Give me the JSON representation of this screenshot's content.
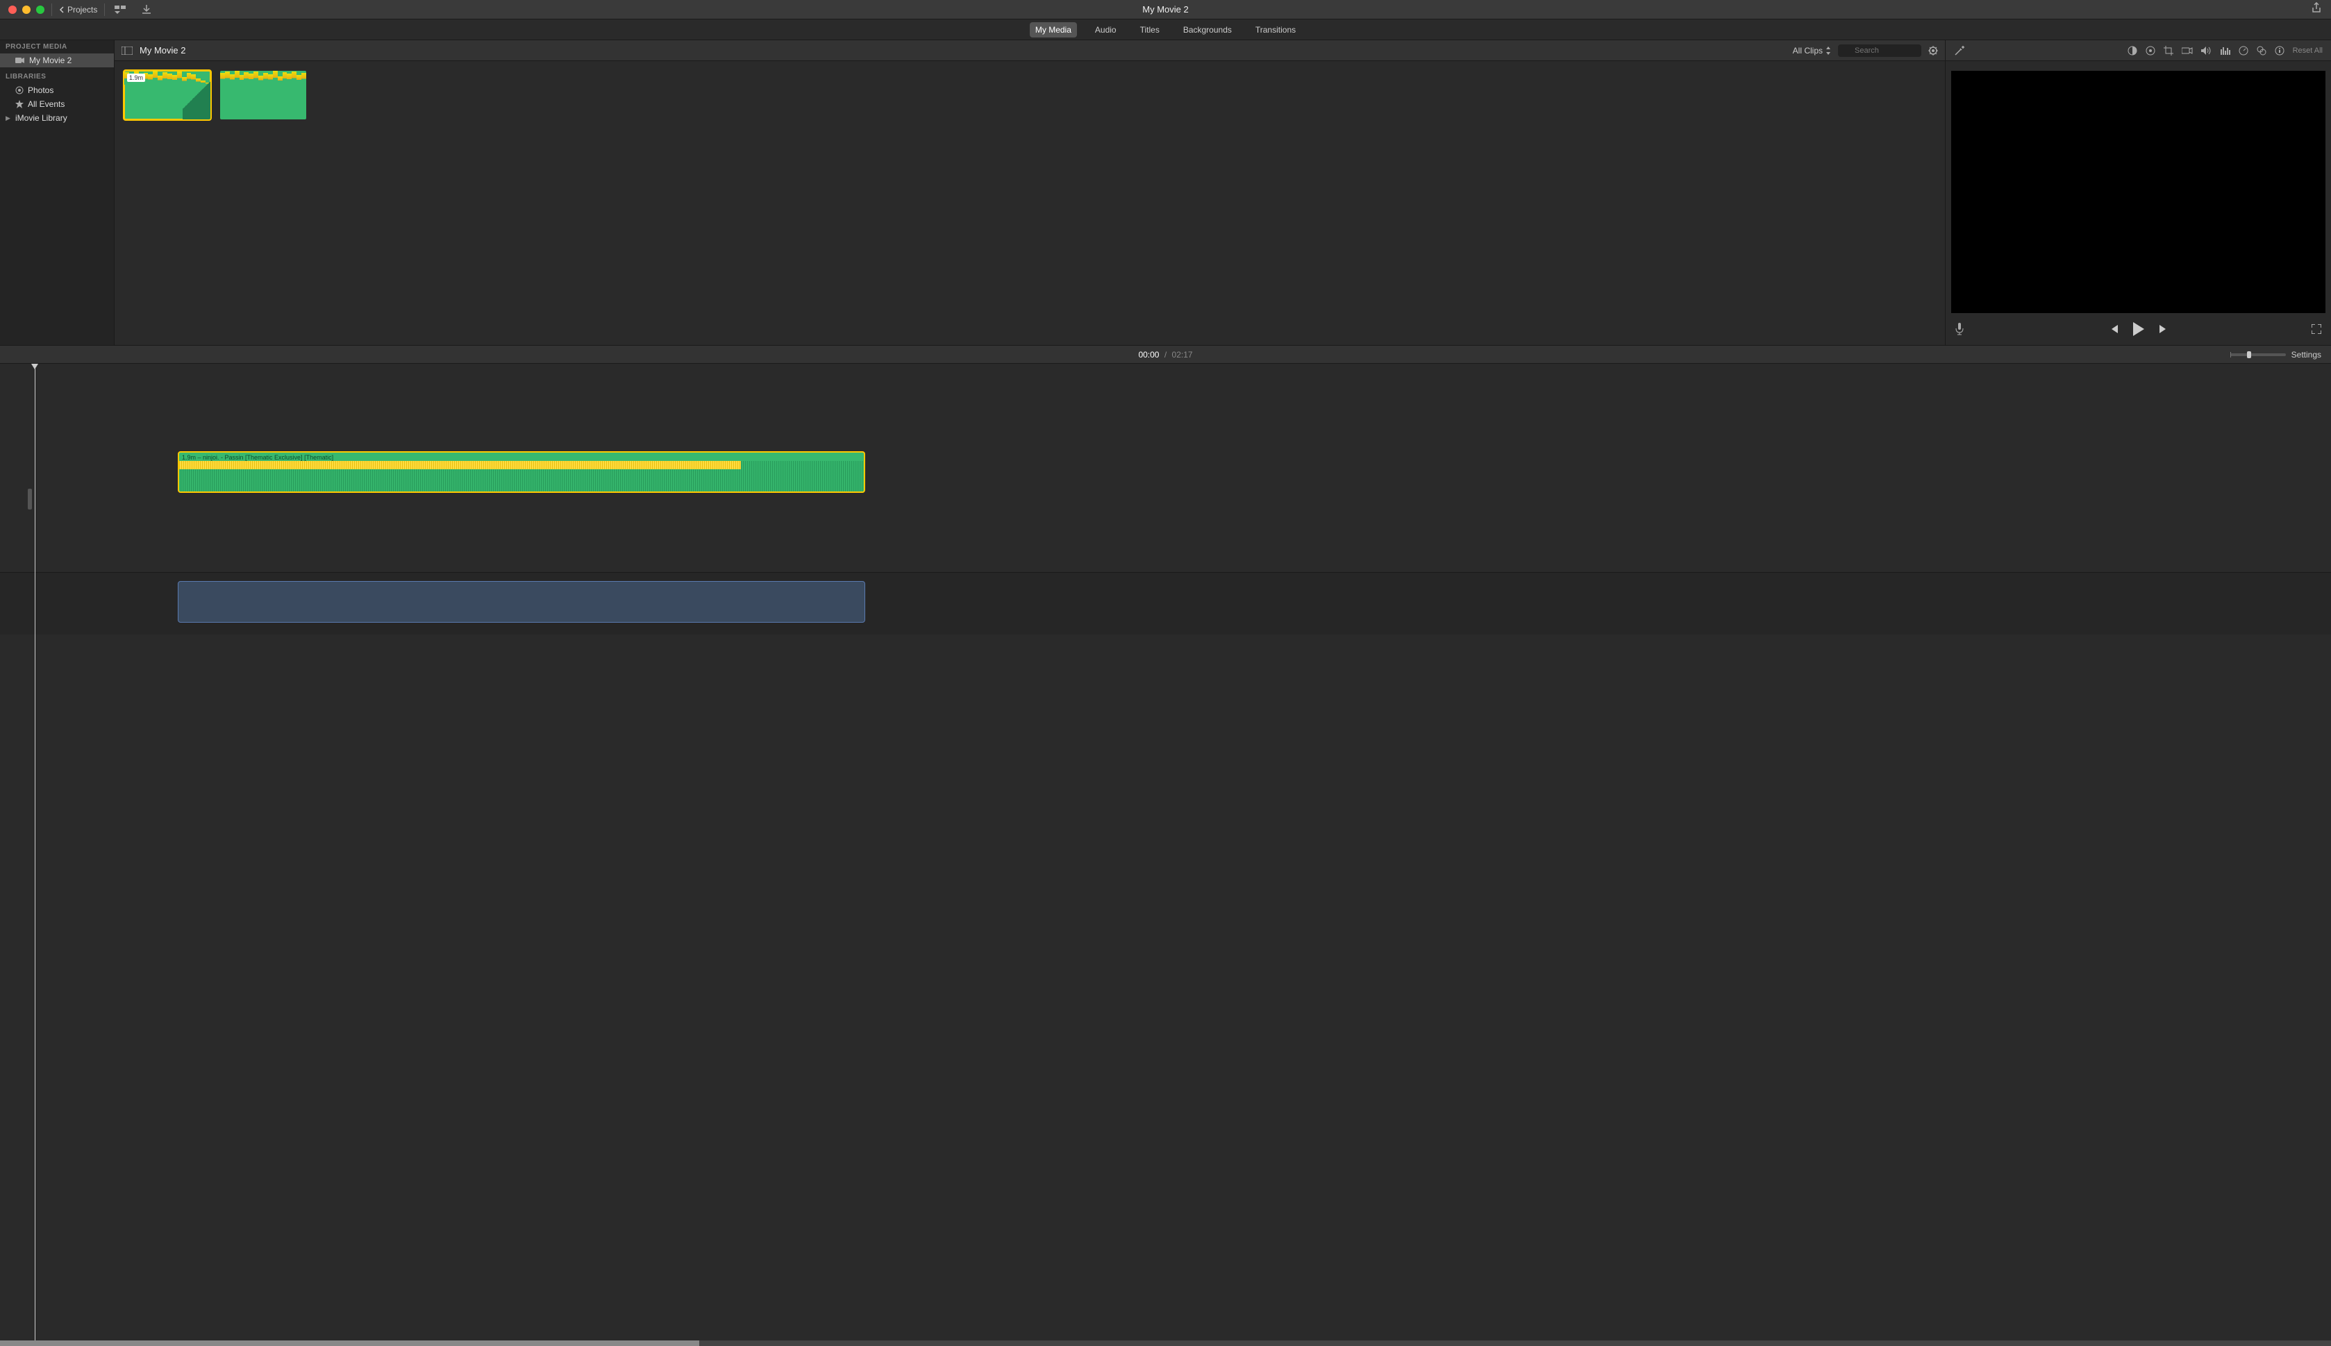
{
  "titlebar": {
    "projects_label": "Projects",
    "window_title": "My Movie 2"
  },
  "content_tabs": {
    "my_media": "My Media",
    "audio": "Audio",
    "titles": "Titles",
    "backgrounds": "Backgrounds",
    "transitions": "Transitions"
  },
  "viewer_toolbar": {
    "reset_all": "Reset All"
  },
  "sidebar": {
    "project_media_label": "PROJECT MEDIA",
    "project_name": "My Movie 2",
    "libraries_label": "LIBRARIES",
    "photos": "Photos",
    "all_events": "All Events",
    "imovie_library": "iMovie Library"
  },
  "browser": {
    "title": "My Movie 2",
    "filter_label": "All Clips",
    "search_placeholder": "Search",
    "clip1_duration": "1.9m"
  },
  "timeline_header": {
    "current_time": "00:00",
    "separator": "/",
    "duration": "02:17",
    "settings_label": "Settings"
  },
  "timeline": {
    "audio_clip_label": "1.9m – ninjoi. - Passin [Thematic Exclusive] [Thematic]"
  },
  "icons": {
    "close": "close-icon",
    "minimize": "minimize-icon",
    "zoom": "zoom-icon",
    "back": "chevron-left-icon",
    "view_mode": "view-mode-icon",
    "import": "import-icon",
    "share": "share-icon",
    "enhance": "magic-wand-icon",
    "color_balance": "color-balance-icon",
    "color_correct": "color-wheel-icon",
    "crop": "crop-icon",
    "stabilize": "camera-icon",
    "volume": "speaker-icon",
    "eq": "equalizer-icon",
    "speed": "speedometer-icon",
    "info": "info-icon",
    "sidebar_toggle": "sidebar-toggle-icon",
    "gear": "gear-icon",
    "search": "search-icon",
    "mic": "microphone-icon",
    "prev": "skip-back-icon",
    "play": "play-icon",
    "next": "skip-forward-icon",
    "fullscreen": "fullscreen-icon",
    "camcorder": "camcorder-icon",
    "photos": "photos-icon",
    "star": "star-icon",
    "updown": "up-down-icon",
    "effects": "effects-icon"
  }
}
